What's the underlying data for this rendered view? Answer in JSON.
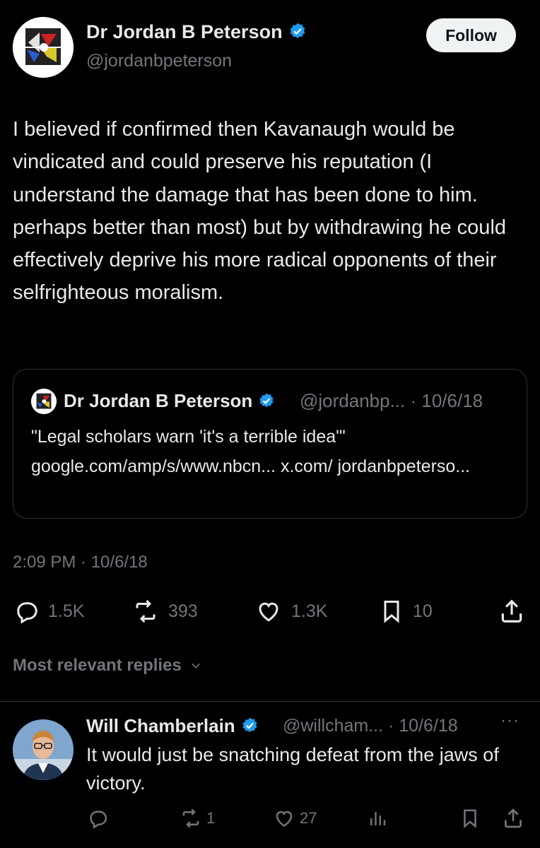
{
  "tweet": {
    "author_name": "Dr Jordan B Peterson",
    "handle": "@jordanbpeterson",
    "follow_label": "Follow",
    "text": "I believed if confirmed then Kavanaugh would be vindicated and could preserve his reputation (I understand the damage that has been done to him. perhaps better than most) but by withdrawing he could effectively deprive his more radical opponents of their selfrighteous moralism.",
    "timestamp": "2:09 PM · 10/6/18",
    "stats": {
      "replies": "1.5K",
      "reposts": "393",
      "likes": "1.3K",
      "bookmarks": "10"
    }
  },
  "quote": {
    "author_name": "Dr Jordan B Peterson",
    "handle_date": "@jordanbp... · 10/6/18",
    "text": "\"Legal scholars warn 'it's a terrible idea'\" google.com/amp/s/www.nbcn... x.com/ jordanbpeterso..."
  },
  "replies_section": {
    "label": "Most relevant replies"
  },
  "reply": {
    "author_name": "Will Chamberlain",
    "handle_date": "@willcham... · 10/6/18",
    "more": "···",
    "text": "It would just be snatching defeat from the jaws of victory.",
    "stats": {
      "reposts": "1",
      "likes": "27"
    }
  },
  "colors": {
    "background": "#000000",
    "text": "#e7e9ea",
    "muted": "#71767b",
    "verified": "#1d9bf0",
    "border": "#2f3336"
  },
  "icons": [
    "verified-badge-icon",
    "reply-icon",
    "repost-icon",
    "like-icon",
    "bookmark-icon",
    "share-icon",
    "views-icon",
    "chevron-down-icon"
  ]
}
